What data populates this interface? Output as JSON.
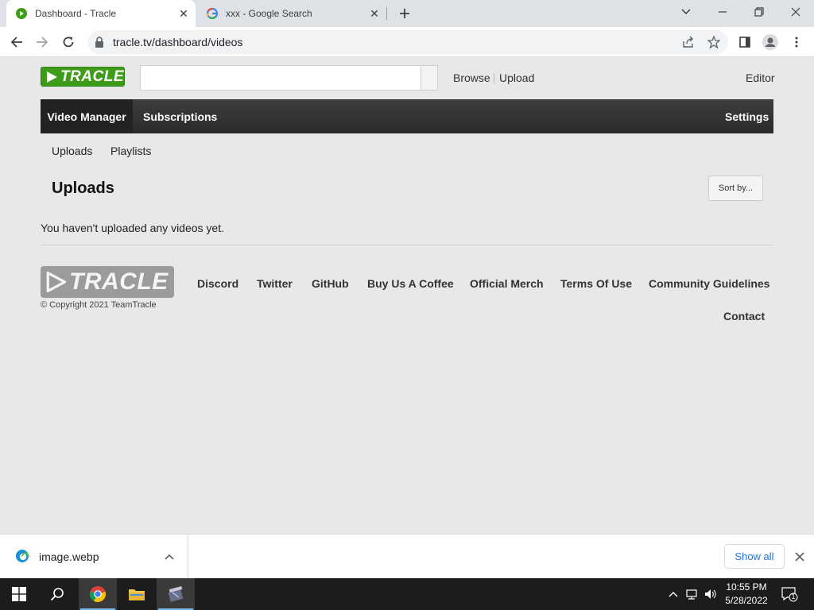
{
  "browser": {
    "tabs": [
      {
        "title": "Dashboard - Tracle",
        "active": true
      },
      {
        "title": "xxx - Google Search",
        "active": false
      }
    ],
    "url": "tracle.tv/dashboard/videos"
  },
  "site": {
    "logo": "TRACLE",
    "search": {
      "value": "",
      "placeholder": ""
    },
    "top_links": {
      "browse": "Browse",
      "upload": "Upload",
      "editor": "Editor"
    },
    "nav": {
      "video_manager": "Video Manager",
      "subscriptions": "Subscriptions",
      "settings": "Settings"
    },
    "subnav": {
      "uploads": "Uploads",
      "playlists": "Playlists"
    },
    "heading": "Uploads",
    "sort_label": "Sort by...",
    "empty_message": "You haven't uploaded any videos yet.",
    "footer": {
      "logo": "TRACLE",
      "copyright": "© Copyright 2021 TeamTracle",
      "links": [
        "Discord",
        "Twitter",
        "GitHub",
        "Buy Us A Coffee",
        "Official Merch",
        "Terms Of Use",
        "Community Guidelines"
      ],
      "contact": "Contact"
    }
  },
  "downloads": {
    "file_name": "image.webp",
    "show_all": "Show all"
  },
  "taskbar": {
    "time": "10:55 PM",
    "date": "5/28/2022",
    "notification_count": "1"
  },
  "colors": {
    "brand_green": "#3d9c18",
    "nav_dark": "#2a2a2a",
    "page_bg": "#e8e8e8",
    "link_blue": "#1a73e8"
  }
}
